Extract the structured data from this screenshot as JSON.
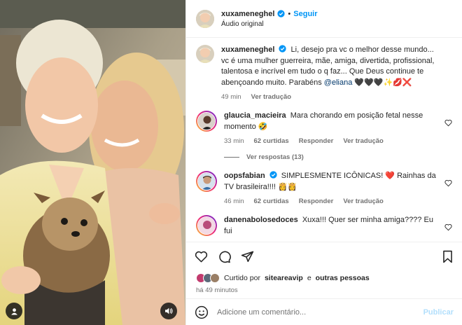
{
  "header": {
    "username": "xuxameneghel",
    "separator": "•",
    "follow_label": "Seguir",
    "audio_label": "Áudio original"
  },
  "caption": {
    "username": "xuxameneghel",
    "text": "Li, desejo pra vc o melhor desse mundo... vc é uma mulher guerreira, mãe, amiga, divertida, profissional, talentosa e incrível em tudo o q faz... Que Deus continue te abençoando muito. Parabéns",
    "mention": "@eliana",
    "emoji_tail": "🖤🖤🖤✨💋❌",
    "time": "49 min",
    "translate_label": "Ver tradução"
  },
  "comments": [
    {
      "username": "glaucia_macieira",
      "text": "Mara chorando em posição fetal nesse momento 🤣",
      "time": "33 min",
      "likes": "62 curtidas",
      "reply_label": "Responder",
      "translate_label": "Ver tradução",
      "replies_label": "Ver respostas (13)"
    },
    {
      "username": "oopsfabian",
      "text": "SIMPLESMENTE ICÔNICAS! ❤️ Rainhas da TV brasileira!!!! 👸👸",
      "time": "46 min",
      "likes": "62 curtidas",
      "reply_label": "Responder",
      "translate_label": "Ver tradução"
    },
    {
      "username": "danenabolosedoces",
      "text": "Xuxa!!! Quer ser minha amiga???? Eu fui"
    }
  ],
  "likes": {
    "prefix": "Curtido por",
    "user": "siteareavip",
    "connector": "e",
    "others": "outras pessoas"
  },
  "posted_time": "há 49 minutos",
  "add_comment": {
    "placeholder": "Adicione um comentário...",
    "publish_label": "Publicar"
  },
  "colors": {
    "accent": "#0095f6",
    "verified": "#0095f6",
    "muted": "#737373",
    "text": "#262626"
  }
}
